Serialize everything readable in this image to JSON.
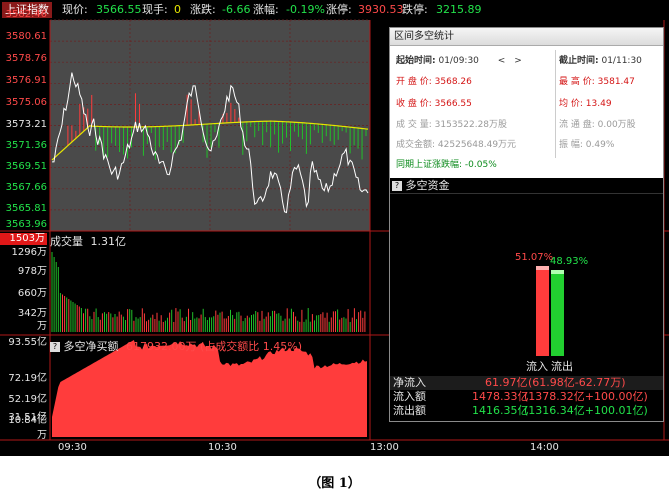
{
  "topbar": {
    "index_name": "上证指数",
    "price_label": "现价:",
    "price": "3566.55",
    "lot_label": "现手:",
    "lot": "0",
    "change_label": "涨跌:",
    "change": "-6.66",
    "pct_label": "涨幅:",
    "pct": "-0.19%",
    "limit_up_label": "涨停:",
    "limit_up": "3930.53",
    "limit_down_label": "跌停:",
    "limit_down": "3215.89"
  },
  "price_axis": [
    "3582.46",
    "3580.61",
    "3578.76",
    "3576.91",
    "3575.06",
    "3573.21",
    "3571.36",
    "3569.51",
    "3567.66",
    "3565.81",
    "3563.96"
  ],
  "volume": {
    "title": "成交量",
    "total": "1.31亿",
    "highlight": "1503万",
    "axis": [
      "1296万",
      "978万",
      "660万",
      "342万",
      "万"
    ]
  },
  "netbuy": {
    "title": "多空净买额",
    "value": "617932.00万",
    "ratio": "(占成交额比 1.45%)",
    "icon": "help-icon",
    "axis": [
      "93.55亿",
      "72.19亿",
      "52.19亿",
      "31.51亿",
      "10.84亿",
      "万"
    ]
  },
  "time_axis": [
    "09:30",
    "10:30",
    "13:00",
    "14:00"
  ],
  "panel": {
    "title": "区间多空统计",
    "start_label": "起始时间:",
    "start_time": "01/09:30",
    "end_label": "截止时间:",
    "end_time": "01/11:30",
    "nav_prev": "<",
    "nav_next": ">",
    "open_label": "开 盘 价:",
    "open": "3568.26",
    "high_label": "最 高 价:",
    "high": "3581.47",
    "close_label": "收 盘 价:",
    "close": "3566.55",
    "avg_label": "均    价:",
    "avg": "13.49",
    "vol_label": "成 交 量:",
    "vol": "3153522.28万股",
    "float_label": "流 通 盘:",
    "float": "0.00万股",
    "amount_label": "成交金额:",
    "amount": "42525648.49万元",
    "amp_label": "振    幅:",
    "amp": "0.49%",
    "sync_label": "同期上证涨跌幅:",
    "sync": "-0.05%",
    "flow_title": "多空资金",
    "inflow_pct": "51.07%",
    "outflow_pct": "48.93%",
    "inflow_share": 0.5107,
    "outflow_share": 0.4893,
    "bar_in_label": "流入",
    "bar_out_label": "流出",
    "net_in_label": "净流入",
    "net_in": "61.97亿",
    "net_in_detail": "(61.98亿-62.77万)",
    "in_amt_label": "流入额",
    "in_amt": "1478.33亿",
    "in_amt_detail": "(1378.32亿+100.00亿)",
    "out_amt_label": "流出额",
    "out_amt": "1416.35亿",
    "out_amt_detail": "(1316.34亿+100.01亿)"
  },
  "colors": {
    "up": "#ff3c3c",
    "down": "#22c02a",
    "price_line": "#ffffff",
    "avg_line": "#e6e600",
    "area_fill": "#ff3c3c",
    "chart_bg": "#4a4a4a"
  },
  "caption": "（图 1）"
}
